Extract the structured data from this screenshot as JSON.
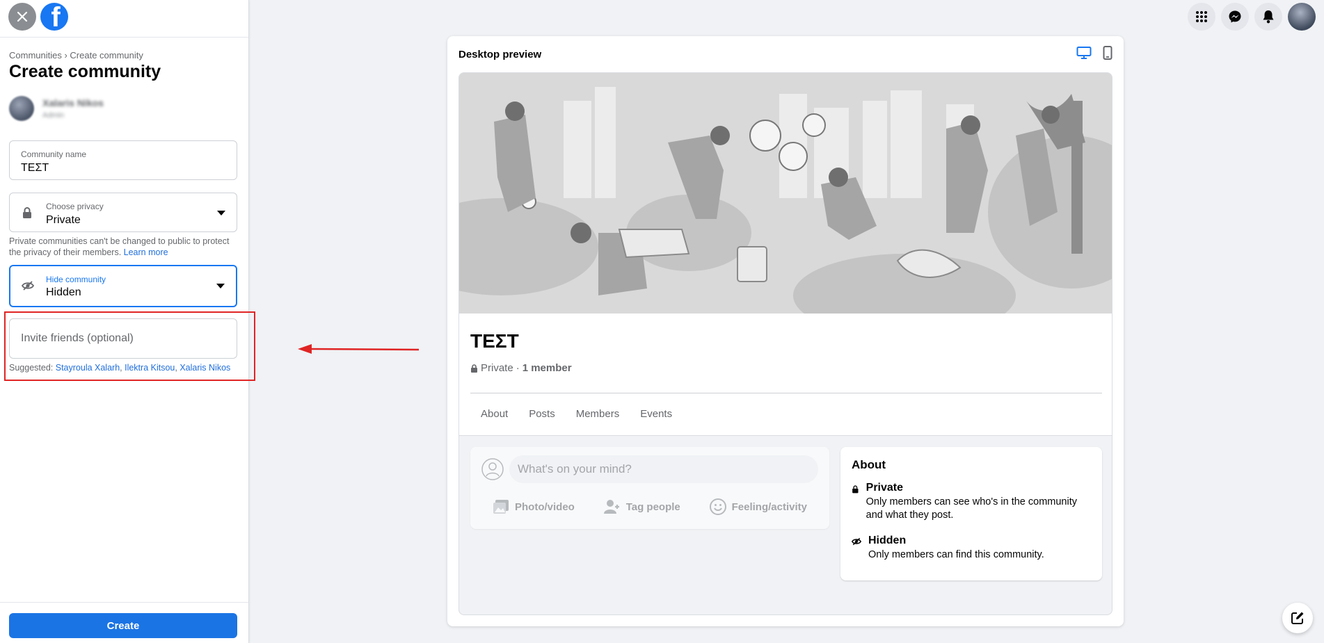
{
  "header": {
    "close_icon": "close-icon",
    "logo_icon": "facebook-logo-icon",
    "logo_letter": "f",
    "right_icons": [
      "menu-grid-icon",
      "messenger-icon",
      "notifications-icon",
      "profile-avatar"
    ]
  },
  "sidebar": {
    "breadcrumb": "Communities › Create community",
    "title": "Create community",
    "owner_name": "Xalaris Nikos",
    "owner_role": "Admin",
    "community_name": {
      "label": "Community name",
      "value": "ΤΕΣΤ"
    },
    "privacy": {
      "label": "Choose privacy",
      "value": "Private",
      "icon": "lock-icon"
    },
    "privacy_note": "Private communities can't be changed to public to protect the privacy of their members.",
    "learn_more": "Learn more",
    "hide": {
      "label": "Hide community",
      "value": "Hidden",
      "icon": "eye-icon"
    },
    "invite_placeholder": "Invite friends (optional)",
    "suggested_label": "Suggested:",
    "suggested_names": [
      "Stayroula Xalarh",
      "Ilektra Kitsou",
      "Xalaris Nikos"
    ],
    "create_label": "Create"
  },
  "preview": {
    "title": "Desktop preview",
    "name": "ΤΕΣΤ",
    "privacy": "Private",
    "separator": "·",
    "members": "1 member",
    "tabs": [
      "About",
      "Posts",
      "Members",
      "Events"
    ],
    "composer_placeholder": "What's on your mind?",
    "actions": [
      "Photo/video",
      "Tag people",
      "Feeling/activity"
    ],
    "about_title": "About",
    "about_items": [
      {
        "title": "Private",
        "desc": "Only members can see who's in the community and what they post."
      },
      {
        "title": "Hidden",
        "desc": "Only members can find this community."
      }
    ]
  },
  "colors": {
    "accent": "#1877f2",
    "create_button": "#1b74e4",
    "highlight": "#e02424",
    "link": "#216fdb"
  }
}
